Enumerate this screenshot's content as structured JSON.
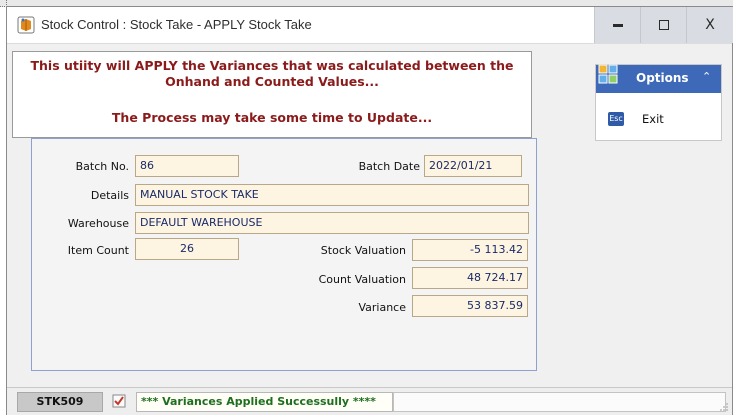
{
  "window": {
    "title": "Stock Control : Stock Take - APPLY Stock Take",
    "minimize_icon": "minimize-icon",
    "maximize_icon": "maximize-icon",
    "close_icon": "close-icon",
    "close_glyph": "X"
  },
  "notice": {
    "line1": "This utiity will APPLY the Variances that was calculated between the",
    "line2": "Onhand and Counted Values...",
    "line3": "The Process may take some time to Update...",
    "color": "#8b1a1a"
  },
  "form": {
    "batch_no": {
      "label": "Batch No.",
      "value": "86"
    },
    "batch_date": {
      "label": "Batch Date",
      "value": "2022/01/21"
    },
    "details": {
      "label": "Details",
      "value": "MANUAL STOCK TAKE"
    },
    "warehouse": {
      "label": "Warehouse",
      "value": "DEFAULT WAREHOUSE"
    },
    "item_count": {
      "label": "Item Count",
      "value": "26"
    },
    "stock_valuation": {
      "label": "Stock Valuation",
      "value": "-5 113.42"
    },
    "count_valuation": {
      "label": "Count Valuation",
      "value": "48 724.17"
    },
    "variance": {
      "label": "Variance",
      "value": "53 837.59"
    }
  },
  "options": {
    "title": "Options",
    "header_color": "#3e69b8",
    "icon": "options-grid-icon",
    "collapse_icon": "chevron-double-up-icon",
    "collapse_glyph": "⌃",
    "items": [
      {
        "label": "Exit",
        "icon": "esc-key-icon",
        "icon_text": "Esc"
      }
    ]
  },
  "statusbar": {
    "code": "STK509",
    "icon": "checklist-icon",
    "message": "*** Variances Applied Successully ****",
    "message_color": "#1d6f1d"
  }
}
